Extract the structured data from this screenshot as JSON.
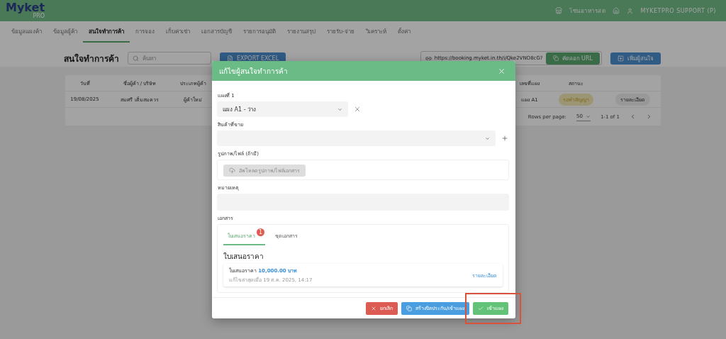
{
  "app": {
    "logo": "Myket",
    "logo_sub": "PRO",
    "market": "โซนอาหารสด",
    "user": "MYKETPRO SUPPORT (P)"
  },
  "nav_tabs": [
    {
      "label": "ข้อมูลแผงค้า",
      "selected": false
    },
    {
      "label": "ข้อมูลผู้ค้า",
      "selected": false
    },
    {
      "label": "สนใจทำการค้า",
      "selected": true
    },
    {
      "label": "การจอง",
      "selected": false
    },
    {
      "label": "เก็บค่าเช่า",
      "selected": false
    },
    {
      "label": "เอกสารบัญชี",
      "selected": false
    },
    {
      "label": "รายการอนุมัติ",
      "selected": false
    },
    {
      "label": "รายงานสรุป",
      "selected": false
    },
    {
      "label": "รายรับ-จ่าย",
      "selected": false
    },
    {
      "label": "วิเคราะห์",
      "selected": false
    },
    {
      "label": "ตั้งค่า",
      "selected": false
    }
  ],
  "page": {
    "title": "สนใจทำการค้า",
    "search_placeholder": "ค้นหา",
    "export_button": "EXPORT EXCEL",
    "booking_url": "https://booking.myket.in.th/i/Qke2VNO8cG?",
    "copy_button": "คัดลอก URL",
    "add_button": "เพิ่มผู้สนใจ"
  },
  "table": {
    "columns": [
      "วันที่",
      "ชื่อผู้ค้า / บริษัท",
      "ประเภทผู้ค้า",
      "เลขที่แผง",
      "สถานะ"
    ],
    "rows": [
      {
        "date": "19/08/2025",
        "name": "สมศรี เต็มสมควร",
        "type": "ผู้ค้าใหม่",
        "stall": "แผง A1",
        "status": "รอทำสัญญา",
        "action": "รายละเอียด"
      }
    ],
    "footer": {
      "rows_per_page_label": "Rows per page:",
      "rows_per_page": "50",
      "range": "1-1 of 1"
    }
  },
  "dialog": {
    "title": "แก้ไขผู้สนใจทำการค้า",
    "stall_label": "แผงที่ 1",
    "stall_value": "แผง A1 - ว่าง",
    "product_label": "สินค้าที่ขาย",
    "upload_label": "รูปภาพ/ไฟล์ (ถ้ามี)",
    "upload_button": "อัพโหลดรูปภาพ/ไฟล์เอกสาร",
    "note_label": "หมายเหตุ",
    "documents_label": "เอกสาร",
    "doc_tabs": [
      {
        "label": "ใบเสนอราคา",
        "selected": true,
        "badge": "1"
      },
      {
        "label": "ชุดเอกสาร",
        "selected": false
      }
    ],
    "section_title": "ใบเสนอราคา",
    "quote": {
      "label": "ใบเสนอราคา",
      "amount": "10,000.00 บาท",
      "edited": "แก้ไขล่าสุดเมื่อ 19 ส.ค. 2025, 14:17",
      "link": "รายละเอียด"
    },
    "buttons": [
      {
        "kind": "cancel",
        "label": "ยกเลิก",
        "highlighted": false
      },
      {
        "kind": "bill",
        "label": "สร้างบิลประกัน/เข้าแผง",
        "highlighted": false
      },
      {
        "kind": "confirm",
        "label": "เข้าแผง",
        "highlighted": true
      }
    ]
  }
}
